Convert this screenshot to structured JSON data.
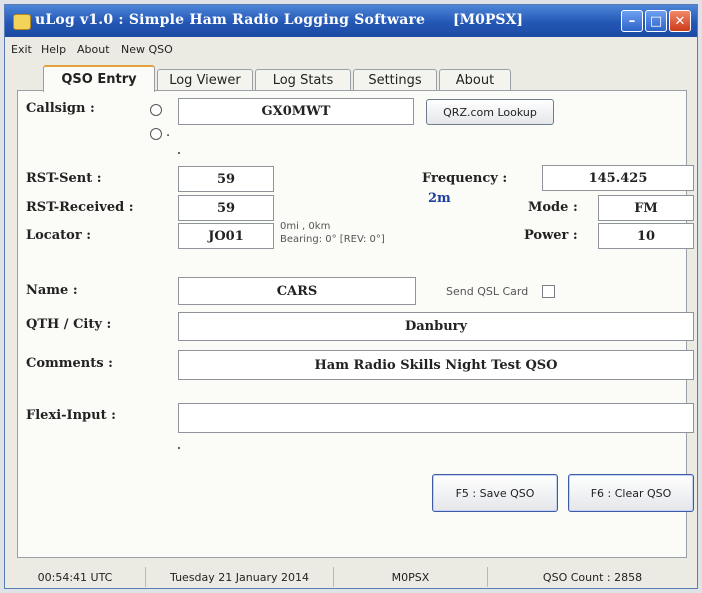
{
  "window": {
    "title": "uLog v1.0 : Simple Ham Radio Logging Software",
    "callsign_tag": "[M0PSX]",
    "min_glyph": "–",
    "max_glyph": "□",
    "close_glyph": "✕"
  },
  "menu": [
    "Exit",
    "Help",
    "About",
    "New QSO"
  ],
  "tabs": [
    "QSO Entry",
    "Log Viewer",
    "Log Stats",
    "Settings",
    "About"
  ],
  "form": {
    "callsign_label": "Callsign :",
    "callsign_value": "GX0MWT",
    "qrz_button": "QRZ.com Lookup",
    "radio_dot": ".",
    "rst_sent_label": "RST-Sent :",
    "rst_sent_value": "59",
    "rst_received_label": "RST-Received :",
    "rst_received_value": "59",
    "locator_label": "Locator :",
    "locator_value": "JO01",
    "distance_text": "0mi , 0km",
    "bearing_text": "Bearing: 0° [REV: 0°]",
    "frequency_label": "Frequency :",
    "frequency_value": "145.425",
    "band_value": "2m",
    "mode_label": "Mode :",
    "mode_value": "FM",
    "power_label": "Power :",
    "power_value": "10",
    "name_label": "Name :",
    "name_value": "CARS",
    "send_qsl_label": "Send QSL Card",
    "qth_label": "QTH / City :",
    "qth_value": "Danbury",
    "comments_label": "Comments :",
    "comments_value": "Ham Radio Skills Night Test QSO",
    "flexi_label": "Flexi-Input :",
    "flexi_value": "",
    "save_button": "F5 : Save QSO",
    "clear_button": "F6 : Clear QSO"
  },
  "status": {
    "time": "00:54:41 UTC",
    "date": "Tuesday 21 January 2014",
    "station": "M0PSX",
    "qso_count": "QSO Count : 2858"
  },
  "colors": {
    "title_bar": "#2457b5",
    "band_text": "#1d3f9e",
    "active_tab_accent": "#e3a23b"
  },
  "icons": [
    "app-icon",
    "minimize-icon",
    "maximize-icon",
    "close-icon"
  ]
}
